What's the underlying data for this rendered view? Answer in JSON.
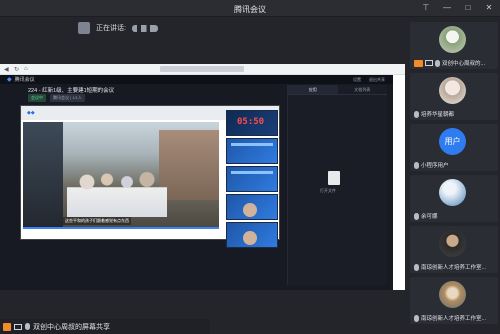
{
  "window": {
    "title": "腾讯会议"
  },
  "speaking": {
    "label": "正在讲话:"
  },
  "share": {
    "app_name": "腾讯会议",
    "meeting_title": "224 - 红新1级、主要建1短期的会议",
    "tags": [
      "会议中",
      "腾讯会议 | 1/1人"
    ],
    "side_tabs": [
      "应用",
      "文档列表"
    ],
    "file_label": "打开文件",
    "clock": "05:50",
    "subtitle": "这些平和的孩子们跟着感觉有点东西",
    "top_right": [
      "设置",
      "退出共享"
    ]
  },
  "participants": [
    {
      "name": "双创中心周叔的..."
    },
    {
      "name": "培养华星朝都"
    },
    {
      "name": "小程序用户",
      "avatar_text": "用户"
    },
    {
      "name": "余可娜"
    },
    {
      "name": "南琼创新人才培养工作室..."
    },
    {
      "name": "南琼创新人才培养工作室..."
    }
  ],
  "bottom": {
    "text": "双创中心周叔的屏幕共享"
  },
  "colors": {
    "accent": "#3b82f6",
    "badge_orange": "#f28c28",
    "clock_red": "#ff4b4b"
  }
}
